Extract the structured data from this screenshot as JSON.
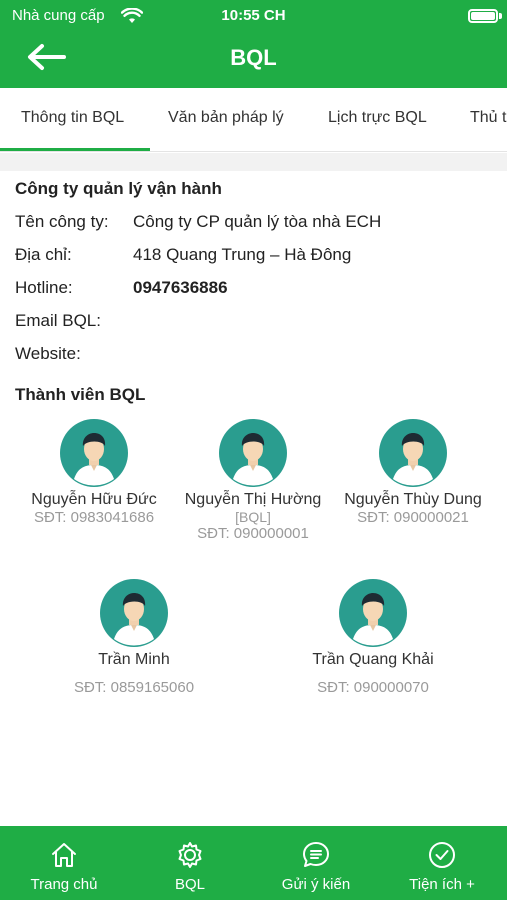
{
  "status_bar": {
    "carrier": "Nhà cung cấp",
    "time": "10:55 CH"
  },
  "header": {
    "title": "BQL"
  },
  "tabs": [
    {
      "label": "Thông tin BQL",
      "active": true
    },
    {
      "label": "Văn bản pháp lý",
      "active": false
    },
    {
      "label": "Lịch trực BQL",
      "active": false
    },
    {
      "label": "Thủ tục",
      "active": false
    }
  ],
  "company": {
    "section_title": "Công ty quản lý vận hành",
    "name_label": "Tên công ty:",
    "name_value": "Công ty CP quản lý tòa nhà ECH",
    "address_label": "Địa chỉ:",
    "address_value": "418 Quang Trung – Hà Đông",
    "hotline_label": "Hotline:",
    "hotline_value": "0947636886",
    "email_label": "Email BQL:",
    "website_label": "Website:"
  },
  "members": {
    "section_title": "Thành viên BQL",
    "list": [
      {
        "name": "Nguyễn Hữu Đức",
        "role": "",
        "phone": "SĐT: 0983041686"
      },
      {
        "name": "Nguyễn Thị Hường",
        "role": "[BQL]",
        "phone": "SĐT: 090000001"
      },
      {
        "name": "Nguyễn Thùy Dung",
        "role": "",
        "phone": "SĐT: 090000021"
      },
      {
        "name": "Trần Minh",
        "role": "",
        "phone": "SĐT: 0859165060"
      },
      {
        "name": "Trần Quang Khải",
        "role": "",
        "phone": "SĐT: 090000070"
      }
    ]
  },
  "bottom_nav": [
    {
      "label": "Trang chủ",
      "icon": "home-icon"
    },
    {
      "label": "BQL",
      "icon": "gear-icon"
    },
    {
      "label": "Gửi ý kiến",
      "icon": "chat-icon"
    },
    {
      "label": "Tiện ích +",
      "icon": "check-circle-icon"
    }
  ],
  "colors": {
    "brand_green": "#1fad45",
    "avatar_teal": "#2a9d8f",
    "muted_text": "#9a9a9a"
  }
}
